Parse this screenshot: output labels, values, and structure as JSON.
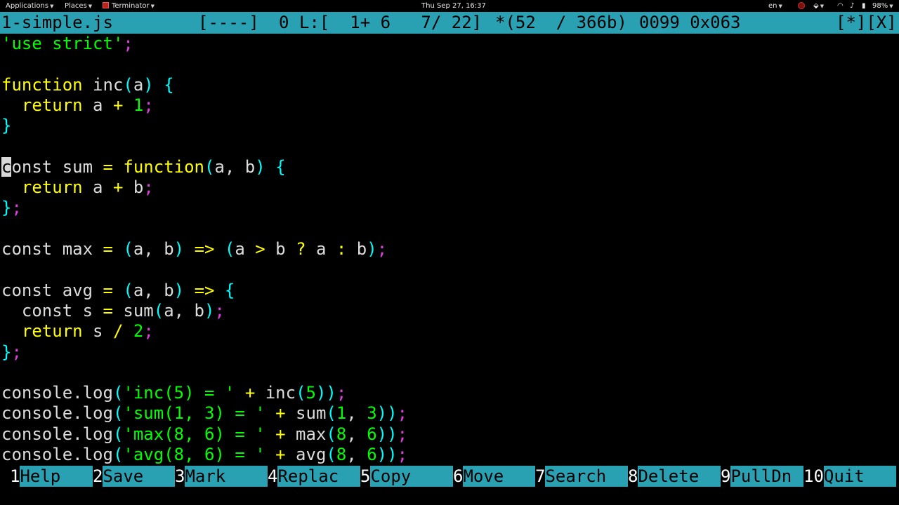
{
  "topbar": {
    "applications": "Applications",
    "places": "Places",
    "terminator": "Terminator",
    "datetime": "Thu Sep 27, 16:37",
    "lang": "en",
    "battery": "98%"
  },
  "status": {
    "filename": "1-simple.js",
    "flags": "[----]",
    "col": "0",
    "pos": "L:[  1+ 6   7/ 22]",
    "chars": "*(52  / 366b)",
    "code": "0099 0x063",
    "buttons": "[*][X]"
  },
  "colors": {
    "keyword": "#ffff00",
    "bracket": "#00ffff",
    "semicolon": "#e040e0",
    "string": "#00ff00",
    "statusbar": "#2aa1b3"
  },
  "code_lines": [
    [
      [
        "str",
        "'use strict'"
      ],
      [
        "sm",
        ";"
      ]
    ],
    [],
    [
      [
        "kw",
        "function"
      ],
      [
        "id",
        " inc"
      ],
      [
        "br",
        "("
      ],
      [
        "id",
        "a"
      ],
      [
        "br",
        ")"
      ],
      [
        "id",
        " "
      ],
      [
        "br",
        "{"
      ]
    ],
    [
      [
        "id",
        "  "
      ],
      [
        "kw",
        "return"
      ],
      [
        "id",
        " a "
      ],
      [
        "op",
        "+"
      ],
      [
        "id",
        " "
      ],
      [
        "num",
        "1"
      ],
      [
        "sm",
        ";"
      ]
    ],
    [
      [
        "br",
        "}"
      ]
    ],
    [],
    [
      [
        "cur",
        "c"
      ],
      [
        "id",
        "onst sum "
      ],
      [
        "op",
        "="
      ],
      [
        "id",
        " "
      ],
      [
        "kw",
        "function"
      ],
      [
        "br",
        "("
      ],
      [
        "id",
        "a, b"
      ],
      [
        "br",
        ")"
      ],
      [
        "id",
        " "
      ],
      [
        "br",
        "{"
      ]
    ],
    [
      [
        "id",
        "  "
      ],
      [
        "kw",
        "return"
      ],
      [
        "id",
        " a "
      ],
      [
        "op",
        "+"
      ],
      [
        "id",
        " b"
      ],
      [
        "sm",
        ";"
      ]
    ],
    [
      [
        "br",
        "}"
      ],
      [
        "sm",
        ";"
      ]
    ],
    [],
    [
      [
        "id",
        "const max "
      ],
      [
        "op",
        "="
      ],
      [
        "id",
        " "
      ],
      [
        "br",
        "("
      ],
      [
        "id",
        "a, b"
      ],
      [
        "br",
        ")"
      ],
      [
        "id",
        " "
      ],
      [
        "op",
        "=>"
      ],
      [
        "id",
        " "
      ],
      [
        "br",
        "("
      ],
      [
        "id",
        "a "
      ],
      [
        "op",
        ">"
      ],
      [
        "id",
        " b "
      ],
      [
        "op",
        "?"
      ],
      [
        "id",
        " a "
      ],
      [
        "op",
        ":"
      ],
      [
        "id",
        " b"
      ],
      [
        "br",
        ")"
      ],
      [
        "sm",
        ";"
      ]
    ],
    [],
    [
      [
        "id",
        "const avg "
      ],
      [
        "op",
        "="
      ],
      [
        "id",
        " "
      ],
      [
        "br",
        "("
      ],
      [
        "id",
        "a, b"
      ],
      [
        "br",
        ")"
      ],
      [
        "id",
        " "
      ],
      [
        "op",
        "=>"
      ],
      [
        "id",
        " "
      ],
      [
        "br",
        "{"
      ]
    ],
    [
      [
        "id",
        "  const s "
      ],
      [
        "op",
        "="
      ],
      [
        "id",
        " sum"
      ],
      [
        "br",
        "("
      ],
      [
        "id",
        "a, b"
      ],
      [
        "br",
        ")"
      ],
      [
        "sm",
        ";"
      ]
    ],
    [
      [
        "id",
        "  "
      ],
      [
        "kw",
        "return"
      ],
      [
        "id",
        " s "
      ],
      [
        "op",
        "/"
      ],
      [
        "id",
        " "
      ],
      [
        "num",
        "2"
      ],
      [
        "sm",
        ";"
      ]
    ],
    [
      [
        "br",
        "}"
      ],
      [
        "sm",
        ";"
      ]
    ],
    [],
    [
      [
        "id",
        "console.log"
      ],
      [
        "br",
        "("
      ],
      [
        "str",
        "'inc(5) = '"
      ],
      [
        "id",
        " "
      ],
      [
        "op",
        "+"
      ],
      [
        "id",
        " inc"
      ],
      [
        "br",
        "("
      ],
      [
        "num",
        "5"
      ],
      [
        "br",
        "))"
      ],
      [
        "sm",
        ";"
      ]
    ],
    [
      [
        "id",
        "console.log"
      ],
      [
        "br",
        "("
      ],
      [
        "str",
        "'sum(1, 3) = '"
      ],
      [
        "id",
        " "
      ],
      [
        "op",
        "+"
      ],
      [
        "id",
        " sum"
      ],
      [
        "br",
        "("
      ],
      [
        "num",
        "1"
      ],
      [
        "id",
        ", "
      ],
      [
        "num",
        "3"
      ],
      [
        "br",
        "))"
      ],
      [
        "sm",
        ";"
      ]
    ],
    [
      [
        "id",
        "console.log"
      ],
      [
        "br",
        "("
      ],
      [
        "str",
        "'max(8, 6) = '"
      ],
      [
        "id",
        " "
      ],
      [
        "op",
        "+"
      ],
      [
        "id",
        " max"
      ],
      [
        "br",
        "("
      ],
      [
        "num",
        "8"
      ],
      [
        "id",
        ", "
      ],
      [
        "num",
        "6"
      ],
      [
        "br",
        "))"
      ],
      [
        "sm",
        ";"
      ]
    ],
    [
      [
        "id",
        "console.log"
      ],
      [
        "br",
        "("
      ],
      [
        "str",
        "'avg(8, 6) = '"
      ],
      [
        "id",
        " "
      ],
      [
        "op",
        "+"
      ],
      [
        "id",
        " avg"
      ],
      [
        "br",
        "("
      ],
      [
        "num",
        "8"
      ],
      [
        "id",
        ", "
      ],
      [
        "num",
        "6"
      ],
      [
        "br",
        "))"
      ],
      [
        "sm",
        ";"
      ]
    ]
  ],
  "fkeys": [
    {
      "num": "1",
      "label": "Help"
    },
    {
      "num": "2",
      "label": "Save"
    },
    {
      "num": "3",
      "label": "Mark"
    },
    {
      "num": "4",
      "label": "Replac"
    },
    {
      "num": "5",
      "label": "Copy"
    },
    {
      "num": "6",
      "label": "Move"
    },
    {
      "num": "7",
      "label": "Search"
    },
    {
      "num": "8",
      "label": "Delete"
    },
    {
      "num": "9",
      "label": "PullDn"
    },
    {
      "num": "10",
      "label": "Quit"
    }
  ]
}
